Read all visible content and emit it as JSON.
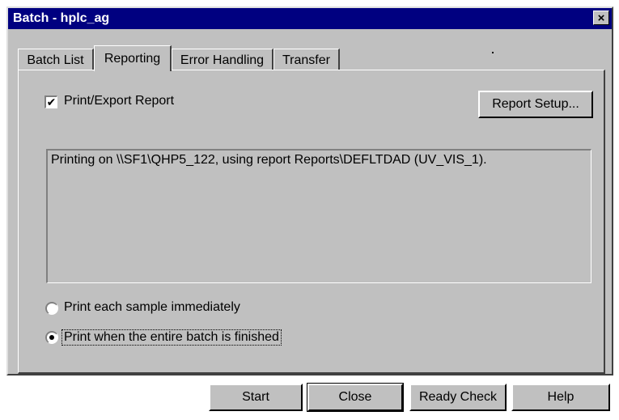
{
  "window": {
    "title": "Batch - hplc_ag",
    "close_glyph": "×"
  },
  "tabs": [
    {
      "label": "Batch List",
      "active": false
    },
    {
      "label": "Reporting",
      "active": true
    },
    {
      "label": "Error Handling",
      "active": false
    },
    {
      "label": "Transfer",
      "active": false
    }
  ],
  "reporting": {
    "print_export_label": "Print/Export Report",
    "print_export_checked": true,
    "check_glyph": "✔",
    "report_setup_label": "Report Setup...",
    "message": "Printing on \\\\SF1\\QHP5_122, using report Reports\\DEFLTDAD (UV_VIS_1).",
    "radio_each_label": "Print each sample immediately",
    "radio_batch_label": "Print when the entire batch is finished",
    "selected_radio": "batch"
  },
  "buttons": {
    "start": "Start",
    "close": "Close",
    "ready_check": "Ready Check",
    "help": "Help"
  },
  "icons": {
    "close": "close-icon",
    "checkmark": "checkmark-icon",
    "radio_dot": "radio-selected-icon"
  }
}
